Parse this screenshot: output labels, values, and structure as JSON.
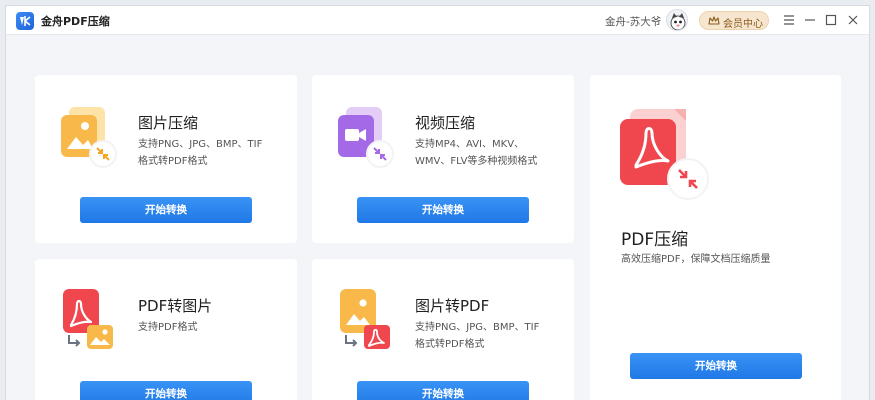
{
  "app": {
    "title": "金舟PDF压缩"
  },
  "header": {
    "user_name": "金舟-苏大爷",
    "member_label": "会员中心"
  },
  "cards": [
    {
      "id": "image-compress",
      "title": "图片压缩",
      "desc_line1": "支持PNG、JPG、BMP、TIF",
      "desc_line2": "格式转PDF格式",
      "button": "开始转换",
      "icon": "image-compress-icon"
    },
    {
      "id": "video-compress",
      "title": "视频压缩",
      "desc_line1": "支持MP4、AVI、MKV、",
      "desc_line2": "WMV、FLV等多种视频格式",
      "button": "开始转换",
      "icon": "video-compress-icon"
    },
    {
      "id": "pdf-compress",
      "title": "PDF压缩",
      "desc_line1": "高效压缩PDF，保障文档压缩质量",
      "button": "开始转换",
      "icon": "pdf-compress-icon"
    },
    {
      "id": "pdf-to-image",
      "title": "PDF转图片",
      "desc_line1": "支持PDF格式",
      "button": "开始转换",
      "icon": "pdf-to-image-icon"
    },
    {
      "id": "image-to-pdf",
      "title": "图片转PDF",
      "desc_line1": "支持PNG、JPG、BMP、TIF",
      "desc_line2": "格式转PDF格式",
      "button": "开始转换",
      "icon": "image-to-pdf-icon"
    }
  ],
  "colors": {
    "accent": "#1f78e6",
    "member_bg": "#f7e6cf"
  }
}
